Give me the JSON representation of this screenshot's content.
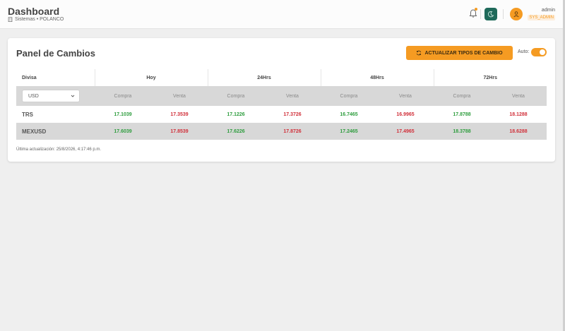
{
  "header": {
    "title": "Dashboard",
    "breadcrumb": "Sistemas • POLANCO",
    "user": {
      "name": "admin",
      "role": "SYS_ADMIN"
    },
    "icons": {
      "bell": "bell-icon",
      "theme": "moon-icon",
      "user": "user-icon",
      "building": "building-icon"
    }
  },
  "panel": {
    "title": "Panel de Cambios",
    "update_button_label": "ACTUALIZAR TIPOS DE CAMBIO",
    "auto_label": "Auto:",
    "auto_enabled": true,
    "last_update": "Última actualización: 25/8/2026, 4:17:46 p.m."
  },
  "table": {
    "currency_header": "Divisa",
    "periods": [
      "Hoy",
      "24Hrs",
      "48Hrs",
      "72Hrs"
    ],
    "buy_label": "Compra",
    "sell_label": "Venta",
    "selected_currency": "USD",
    "rows": [
      {
        "name": "TRS",
        "values": [
          "17.1039",
          "17.3539",
          "17.1226",
          "17.3726",
          "16.7465",
          "16.9965",
          "17.8788",
          "18.1288"
        ]
      },
      {
        "name": "MEXUSD",
        "values": [
          "17.6039",
          "17.8539",
          "17.6226",
          "17.8726",
          "17.2465",
          "17.4965",
          "18.3788",
          "18.6288"
        ]
      }
    ]
  },
  "colors": {
    "accent": "#f59b22",
    "buy": "#2e9d3e",
    "sell": "#d1303a",
    "theme_button": "#1f6a5a"
  }
}
